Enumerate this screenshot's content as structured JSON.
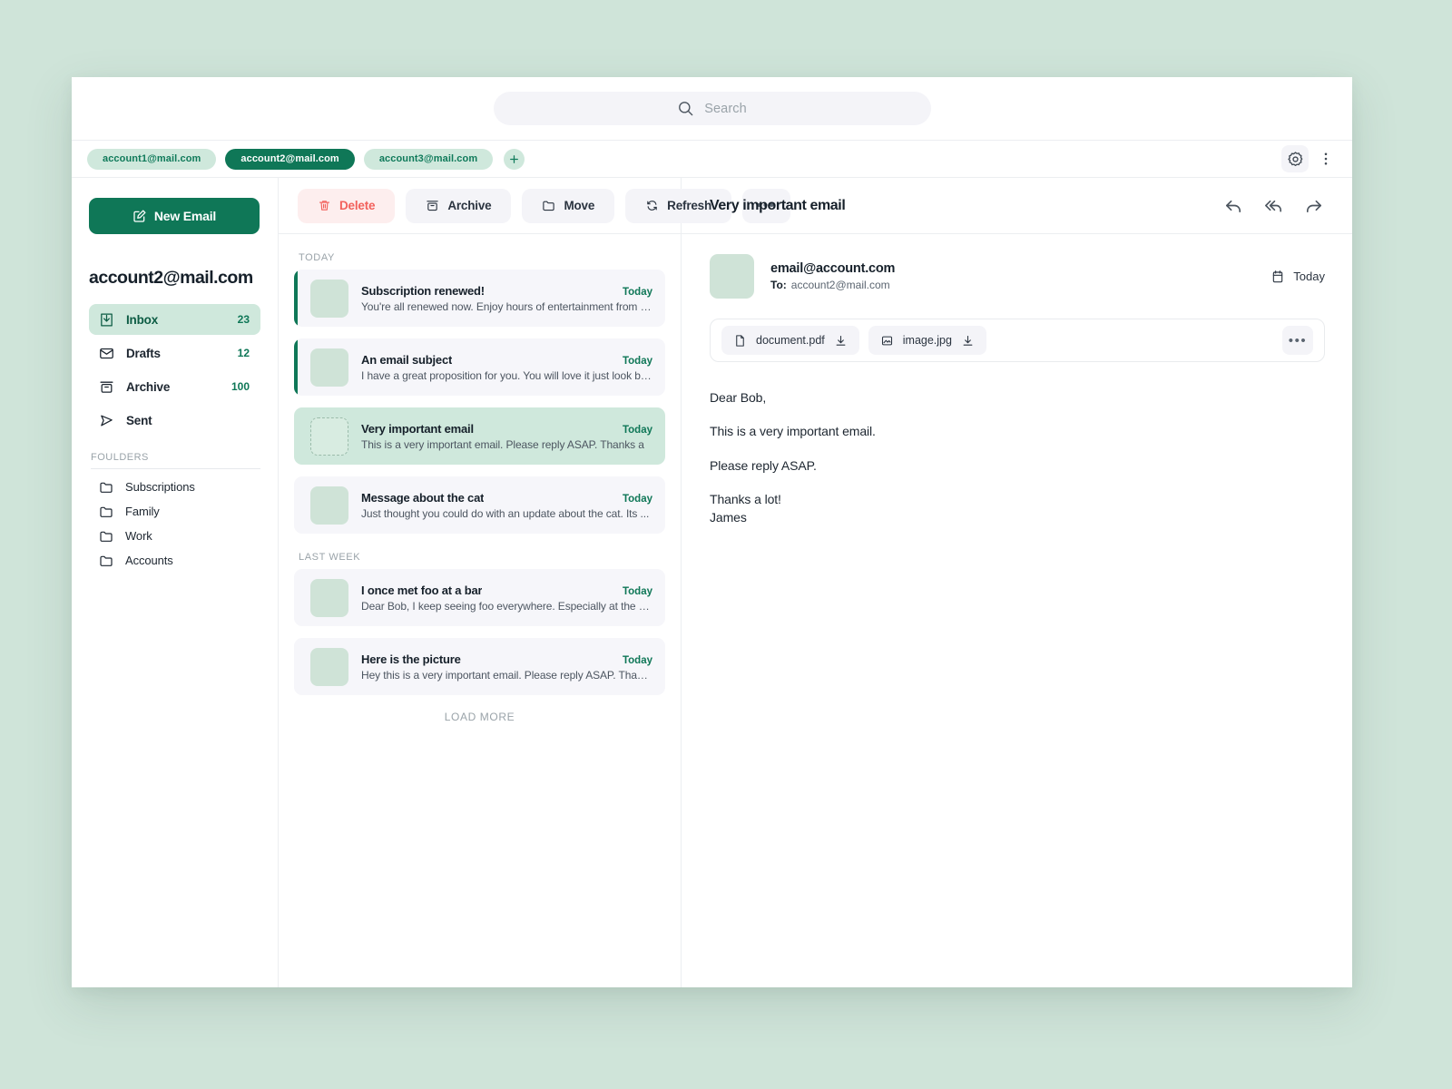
{
  "search": {
    "placeholder": "Search",
    "icon": "search-icon"
  },
  "accounts": {
    "tabs": [
      {
        "label": "account1@mail.com",
        "active": false
      },
      {
        "label": "account2@mail.com",
        "active": true
      },
      {
        "label": "account3@mail.com",
        "active": false
      }
    ],
    "add_label": "+",
    "settings_icon": "gear-icon",
    "overflow_icon": "vertical-dots-icon"
  },
  "sidebar": {
    "new_email_label": "New Email",
    "account_heading": "account2@mail.com",
    "nav": [
      {
        "label": "Inbox",
        "count": "23",
        "icon": "inbox-icon",
        "active": true
      },
      {
        "label": "Drafts",
        "count": "12",
        "icon": "envelope-icon",
        "active": false
      },
      {
        "label": "Archive",
        "count": "100",
        "icon": "archive-icon",
        "active": false
      },
      {
        "label": "Sent",
        "count": "",
        "icon": "paper-plane-icon",
        "active": false
      }
    ],
    "folders_heading": "FOULDERS",
    "folders": [
      {
        "label": "Subscriptions",
        "icon": "folder-icon"
      },
      {
        "label": "Family",
        "icon": "folder-icon"
      },
      {
        "label": "Work",
        "icon": "folder-icon"
      },
      {
        "label": "Accounts",
        "icon": "folder-icon"
      }
    ]
  },
  "toolbar": {
    "delete_label": "Delete",
    "archive_label": "Archive",
    "move_label": "Move",
    "refresh_label": "Refresh",
    "more_label": "•••"
  },
  "list": {
    "groups": [
      {
        "label": "TODAY",
        "items": [
          {
            "subject": "Subscription renewed!",
            "preview": "You're all renewed now. Enjoy hours of entertainment  from th...",
            "date": "Today",
            "unread": true,
            "selected": false
          },
          {
            "subject": "An email subject",
            "preview": "I have a great proposition for you. You will love it just look belo...",
            "date": "Today",
            "unread": true,
            "selected": false
          },
          {
            "subject": "Very important email",
            "preview": "This is a very important email. Please reply ASAP. Thanks a",
            "date": "Today",
            "unread": false,
            "selected": true
          },
          {
            "subject": "Message about the cat",
            "preview": "Just thought you could do with an update about the cat. Its ...",
            "date": "Today",
            "unread": false,
            "selected": false
          }
        ]
      },
      {
        "label": "LAST WEEK",
        "items": [
          {
            "subject": "I once met foo at a bar",
            "preview": "Dear Bob, I keep seeing foo everywhere. Especially at the bar...",
            "date": "Today",
            "unread": false,
            "selected": false
          },
          {
            "subject": "Here is the picture",
            "preview": "Hey this is a very important email. Please reply ASAP. Thanks ...",
            "date": "Today",
            "unread": false,
            "selected": false
          }
        ]
      }
    ],
    "load_more_label": "LOAD MORE"
  },
  "reader": {
    "title": "Very important email",
    "actions": [
      {
        "icon": "reply-icon"
      },
      {
        "icon": "reply-all-icon"
      },
      {
        "icon": "forward-icon"
      }
    ],
    "sender_email": "email@account.com",
    "to_label": "To:",
    "to_value": "account2@mail.com",
    "date": "Today",
    "date_icon": "calendar-icon",
    "attachments": [
      {
        "name": "document.pdf",
        "icon": "file-icon",
        "action_icon": "download-icon"
      },
      {
        "name": "image.jpg",
        "icon": "image-icon",
        "action_icon": "download-icon"
      }
    ],
    "attachments_more_label": "•••",
    "body": [
      "Dear Bob,",
      "This is a very important email.",
      "Please reply ASAP.",
      "Thanks a  lot!"
    ],
    "signature": "James"
  },
  "colors": {
    "page_bg": "#cfe4d9",
    "accent_green": "#0f7757",
    "accent_green_soft": "#cfe8dc",
    "danger_red": "#f2615c",
    "panel_grey": "#f4f4f8"
  }
}
